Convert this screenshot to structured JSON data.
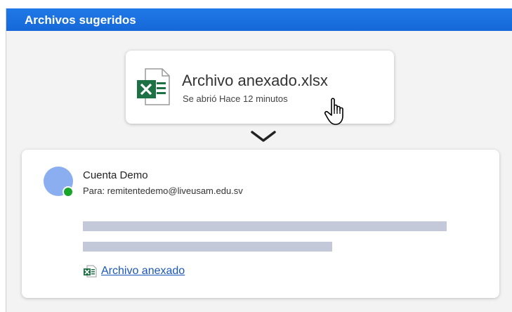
{
  "header": {
    "title": "Archivos sugeridos"
  },
  "suggested_file": {
    "name": "Archivo anexado.xlsx",
    "subtitle": "Se abrió Hace 12 minutos",
    "icon": "excel-file-icon"
  },
  "email": {
    "sender": "Cuenta Demo",
    "to_line": "Para:  remitentedemo@liveusam.edu.sv",
    "attachment_label": "Archivo anexado",
    "presence_color": "#17a52a"
  },
  "colors": {
    "header": "#1a73e8",
    "excel_green": "#1e7145",
    "link": "#1a56b8",
    "avatar": "#8aaef0"
  }
}
